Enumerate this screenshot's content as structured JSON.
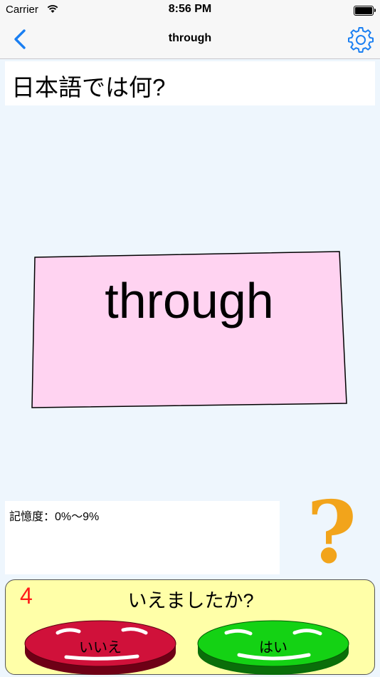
{
  "status_bar": {
    "carrier": "Carrier",
    "time": "8:56 PM"
  },
  "nav": {
    "title": "through",
    "back_icon": "chevron-left-icon",
    "settings_icon": "gear-icon",
    "accent": "#1a7ff2"
  },
  "question": {
    "text": "日本語では何?"
  },
  "card": {
    "word": "through",
    "color": "#ffd3f1"
  },
  "memory": {
    "label": "記憶度：",
    "value": "0%～9%"
  },
  "help": {
    "label": "?"
  },
  "answer_panel": {
    "count": "4",
    "prompt": "いえましたか?",
    "no_label": "いいえ",
    "yes_label": "はい",
    "no_color": "#d0113a",
    "yes_color": "#14d214"
  }
}
